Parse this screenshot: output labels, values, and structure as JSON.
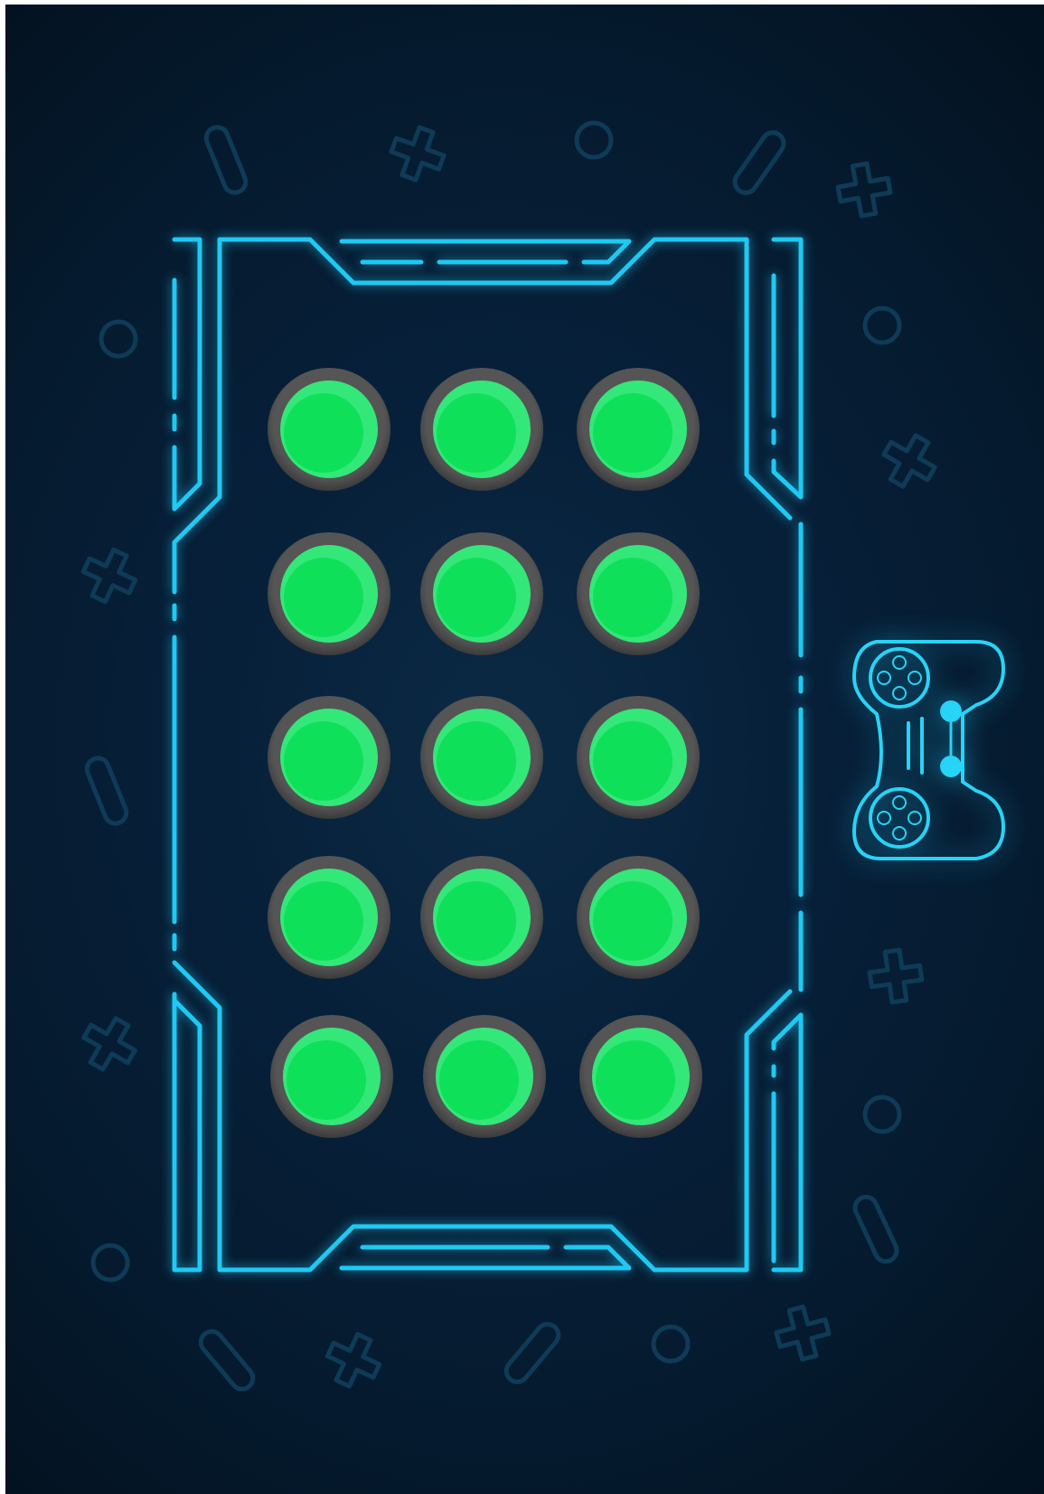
{
  "theme": {
    "background": "#051a2e",
    "neon_frame": "#1ec9f3",
    "decoration": "#0e3b57",
    "button_fill": "#33e878",
    "button_core": "#0fe05a",
    "button_ring": "#4a4a4a"
  },
  "board": {
    "rows": 5,
    "columns": 3,
    "buttons": [
      {
        "row": 1,
        "col": 1,
        "state": "lit"
      },
      {
        "row": 1,
        "col": 2,
        "state": "lit"
      },
      {
        "row": 1,
        "col": 3,
        "state": "lit"
      },
      {
        "row": 2,
        "col": 1,
        "state": "lit"
      },
      {
        "row": 2,
        "col": 2,
        "state": "lit"
      },
      {
        "row": 2,
        "col": 3,
        "state": "lit"
      },
      {
        "row": 3,
        "col": 1,
        "state": "lit"
      },
      {
        "row": 3,
        "col": 2,
        "state": "lit"
      },
      {
        "row": 3,
        "col": 3,
        "state": "lit"
      },
      {
        "row": 4,
        "col": 1,
        "state": "lit"
      },
      {
        "row": 4,
        "col": 2,
        "state": "lit"
      },
      {
        "row": 4,
        "col": 3,
        "state": "lit"
      },
      {
        "row": 5,
        "col": 1,
        "state": "lit"
      },
      {
        "row": 5,
        "col": 2,
        "state": "lit"
      },
      {
        "row": 5,
        "col": 3,
        "state": "lit"
      }
    ]
  },
  "controller": {
    "icon": "gamepad-icon"
  },
  "decorations": {
    "icons": [
      "cross-icon",
      "circle-icon",
      "capsule-icon"
    ]
  }
}
